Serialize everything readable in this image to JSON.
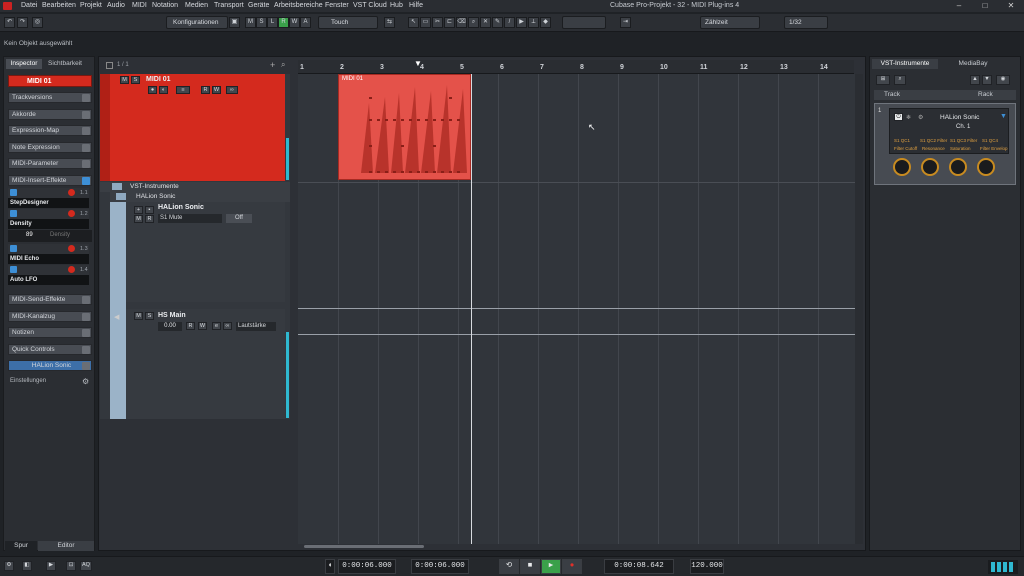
{
  "menubar": {
    "items": [
      "Datei",
      "Bearbeiten",
      "Projekt",
      "Audio",
      "MIDI",
      "Notation",
      "Medien",
      "Transport",
      "Geräte",
      "Arbeitsbereiche",
      "Fenster",
      "VST Cloud",
      "Hub",
      "Hilfe"
    ],
    "window_title": "Cubase Pro-Projekt - 32 - MIDI Plug-ins 4",
    "minimize": "–",
    "maximize": "□",
    "close": "✕"
  },
  "toolbar": {
    "config_label": "Konfigurationen",
    "mode_buttons": [
      "M",
      "S",
      "L",
      "R",
      "W",
      "A"
    ],
    "automation_mode": "Touch",
    "time_format": "Zählzeit",
    "quantize": "1/32"
  },
  "status": {
    "text": "Kein Objekt ausgewählt"
  },
  "inspector": {
    "tab_inspector": "Inspector",
    "tab_visibility": "Sichtbarkeit",
    "track_name": "MIDI 01",
    "sections": [
      "Trackversions",
      "Akkorde",
      "Expression-Map",
      "Note Expression",
      "MIDI-Parameter",
      "MIDI-Insert-Effekte"
    ],
    "insert_slots": [
      {
        "slot": "1.1",
        "name": "StepDesigner"
      },
      {
        "slot": "1.2",
        "name": "Density"
      },
      {
        "slot": "1.3",
        "name": "MIDI Echo"
      },
      {
        "slot": "1.4",
        "name": "Auto LFO"
      }
    ],
    "density_value": "89",
    "density_label": "Density",
    "sections_lower": [
      "MIDI-Send-Effekte",
      "MIDI-Kanalzug",
      "Notizen",
      "Quick Controls"
    ],
    "instrument": "HALion Sonic",
    "settings_label": "Einstellungen",
    "bottom_tab_track": "Spur",
    "bottom_tab_editor": "Editor"
  },
  "project": {
    "track_count": "1 / 1",
    "midi_track": "MIDI 01",
    "folder": "VST-Instrumente",
    "subfolder": "HALion Sonic",
    "instrument_track": "HALion Sonic",
    "instrument_param": "S1 Mute",
    "instrument_value": "Off",
    "output_track": "HS Main",
    "output_volume": "0.00",
    "output_param": "Lautstärke",
    "event_name": "MIDI 01",
    "ruler": [
      "1",
      "2",
      "3",
      "4",
      "5",
      "6",
      "7",
      "8",
      "9",
      "10",
      "11",
      "12",
      "13",
      "14"
    ]
  },
  "rightzone": {
    "tab_vst": "VST-Instrumente",
    "tab_media": "MediaBay",
    "col_track": "Track",
    "col_rack": "Rack",
    "slot_number": "1",
    "instrument_name": "HALion Sonic",
    "channel": "Ch. 1",
    "qc_labels": [
      "S1 QC1",
      "S1 QC2 Filter",
      "S1 QC3 Filter",
      "S1 QC4"
    ],
    "qc_names": [
      "Filter Cutoff",
      "Resonance",
      "Saturation",
      "Filter Envelop"
    ]
  },
  "transport": {
    "left_locator": "0:00:06.000",
    "right_locator": "0:00:06.000",
    "position": "0:00:08.642",
    "tempo": "120.000"
  },
  "colors": {
    "midi_track": "#d42a1e",
    "event": "#e4524a",
    "accent_blue": "#3d8fd6"
  }
}
